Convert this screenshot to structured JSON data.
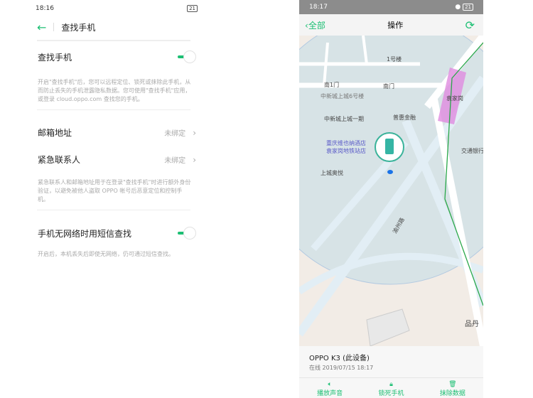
{
  "left": {
    "status": {
      "time": "18:16",
      "battery": "21"
    },
    "header": {
      "title": "查找手机"
    },
    "find_phone": {
      "label": "查找手机",
      "enabled": true,
      "desc": "开启\"查找手机\"后，您可以远程定位、锁死或抹除此手机，从而防止丢失的手机泄露隐私数据。您可使用\"查找手机\"应用，或登录 cloud.oppo.com 查找您的手机。"
    },
    "email": {
      "label": "邮箱地址",
      "value": "未绑定"
    },
    "contact": {
      "label": "紧急联系人",
      "value": "未绑定"
    },
    "contact_desc": "紧急联系人和邮箱地址用于在登录\"查找手机\"时进行额外身份验证，以避免被他人盗取 OPPO 帐号后恶意定位和控制手机。",
    "sms": {
      "label": "手机无网络时用短信查找",
      "enabled": true,
      "desc": "开启后，本机丢失后即使无网络，仍可通过短信查找。"
    }
  },
  "right": {
    "status": {
      "time": "18:17",
      "battery": "21"
    },
    "header": {
      "back": "全部",
      "title": "操作"
    },
    "map": {
      "labels": [
        "1号楼",
        "南1门",
        "南门",
        "中新城上城6号楼",
        "袁家岗",
        "中新城上城一期",
        "普惠金融",
        "重庆维也纳酒店",
        "袁家岗地铁站店",
        "交通银行",
        "上城奥悦",
        "渝州路",
        "品丹"
      ]
    },
    "device": {
      "name": "OPPO K3 (此设备)",
      "status": "在线",
      "time": "2019/07/15 18:17"
    },
    "actions": [
      {
        "label": "播放声音",
        "icon": "speaker-icon"
      },
      {
        "label": "锁死手机",
        "icon": "lock-icon"
      },
      {
        "label": "抹除数据",
        "icon": "trash-icon"
      }
    ],
    "accent": "#1cbf73"
  }
}
